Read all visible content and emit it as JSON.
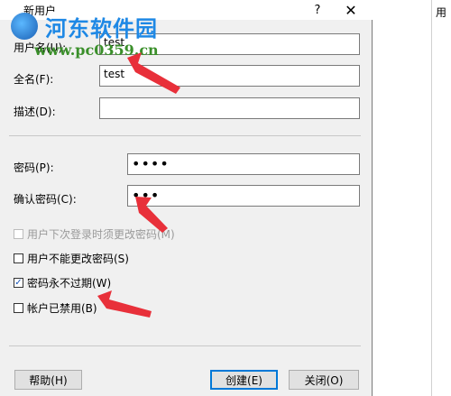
{
  "window": {
    "title": "新用户",
    "help_glyph": "?",
    "close_glyph": "✕"
  },
  "watermark": {
    "name": "河东软件园",
    "url": "www.pc0359.cn"
  },
  "fields": {
    "username": {
      "label": "用户名(U):",
      "value": "test"
    },
    "fullname": {
      "label": "全名(F):",
      "value": "test"
    },
    "description": {
      "label": "描述(D):",
      "value": ""
    },
    "password": {
      "label": "密码(P):",
      "value": "••••"
    },
    "confirm": {
      "label": "确认密码(C):",
      "value": "•••"
    }
  },
  "checkboxes": [
    {
      "label": "用户下次登录时须更改密码(M)",
      "checked": false,
      "disabled": true
    },
    {
      "label": "用户不能更改密码(S)",
      "checked": false,
      "disabled": false
    },
    {
      "label": "密码永不过期(W)",
      "checked": true,
      "disabled": false
    },
    {
      "label": "帐户已禁用(B)",
      "checked": false,
      "disabled": false
    }
  ],
  "buttons": {
    "help": "帮助(H)",
    "create": "创建(E)",
    "close": "关闭(O)"
  },
  "background_window": {
    "edge_text": "用"
  },
  "colors": {
    "annotation_arrow": "#e8303a",
    "checkbox_tick": "#1a56b8",
    "default_button_border": "#0078d7"
  }
}
